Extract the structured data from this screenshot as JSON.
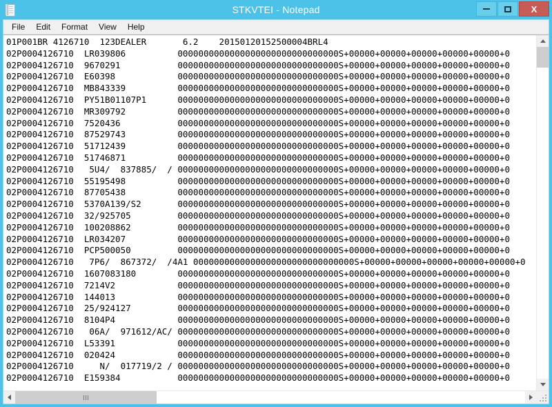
{
  "window": {
    "title": "STKVTEI - Notepad",
    "app_icon": "notepad-icon",
    "titlebar_color": "#4cc2e8",
    "close_button_color": "#c75b56",
    "buttons": {
      "minimize": "minimize-icon",
      "maximize": "maximize-icon",
      "close": "X"
    }
  },
  "menubar": {
    "items": [
      {
        "label": "File"
      },
      {
        "label": "Edit"
      },
      {
        "label": "Format"
      },
      {
        "label": "View"
      },
      {
        "label": "Help"
      }
    ]
  },
  "document": {
    "lines": [
      "01P001BR 4126710  123DEALER       6.2    2015012015250000\u00034BRL4",
      "02P0004126710  LR039806          0000000000000000000000000000000S+00000+00000+00000+00000+00000+0",
      "02P0004126710  9670291           0000000000000000000000000000000S+00000+00000+00000+00000+00000+0",
      "02P0004126710  E60398            0000000000000000000000000000000S+00000+00000+00000+00000+00000+0",
      "02P0004126710  MB843339          0000000000000000000000000000000S+00000+00000+00000+00000+00000+0",
      "02P0004126710  PY51B01107P1      0000000000000000000000000000000S+00000+00000+00000+00000+00000+0",
      "02P0004126710  MR309792          0000000000000000000000000000000S+00000+00000+00000+00000+00000+0",
      "02P0004126710  7520436           0000000000000000000000000000000S+00000+00000+00000+00000+00000+0",
      "02P0004126710  87529743          0000000000000000000000000000000S+00000+00000+00000+00000+00000+0",
      "02P0004126710  51712439          0000000000000000000000000000000S+00000+00000+00000+00000+00000+0",
      "02P0004126710  51746871          0000000000000000000000000000000S+00000+00000+00000+00000+00000+0",
      "02P0004126710   5U4/  837885/  / 0000000000000000000000000000000S+00000+00000+00000+00000+00000+0",
      "02P0004126710  55195498          0000000000000000000000000000000S+00000+00000+00000+00000+00000+0",
      "02P0004126710  87705438          0000000000000000000000000000000S+00000+00000+00000+00000+00000+0",
      "02P0004126710  5370A139/S2       0000000000000000000000000000000S+00000+00000+00000+00000+00000+0",
      "02P0004126710  32/925705         0000000000000000000000000000000S+00000+00000+00000+00000+00000+0",
      "02P0004126710  100208862         0000000000000000000000000000000S+00000+00000+00000+00000+00000+0",
      "02P0004126710  LR034207          0000000000000000000000000000000S+00000+00000+00000+00000+00000+0",
      "02P0004126710  PCP500050         0000000000000000000000000000000S+00000+00000+00000+00000+00000+0",
      "02P0004126710   7P6/  867372/  /4A1 0000000000000000000000000000000S+00000+00000+00000+00000+00000+0",
      "02P0004126710  1607083180        0000000000000000000000000000000S+00000+00000+00000+00000+00000+0",
      "02P0004126710  7214V2            0000000000000000000000000000000S+00000+00000+00000+00000+00000+0",
      "02P0004126710  144013            0000000000000000000000000000000S+00000+00000+00000+00000+00000+0",
      "02P0004126710  25/924127         0000000000000000000000000000000S+00000+00000+00000+00000+00000+0",
      "02P0004126710  8104P4            0000000000000000000000000000000S+00000+00000+00000+00000+00000+0",
      "02P0004126710   06A/  971612/AC/ 0000000000000000000000000000000S+00000+00000+00000+00000+00000+0",
      "02P0004126710  L53391            0000000000000000000000000000000S+00000+00000+00000+00000+00000+0",
      "02P0004126710  020424            0000000000000000000000000000000S+00000+00000+00000+00000+00000+0",
      "02P0004126710     N/  017719/2 / 0000000000000000000000000000000S+00000+00000+00000+00000+00000+0",
      "02P0004126710  E159384           0000000000000000000000000000000S+00000+00000+00000+00000+00000+0"
    ]
  },
  "scrollbars": {
    "vertical": {
      "up_arrow": "scroll-up-arrow-icon",
      "down_arrow": "scroll-down-arrow-icon",
      "thumb": "vertical-scroll-thumb"
    },
    "horizontal": {
      "left_arrow": "scroll-left-arrow-icon",
      "right_arrow": "scroll-right-arrow-icon",
      "thumb": "horizontal-scroll-thumb"
    },
    "resize_grip": "resize-grip-icon"
  }
}
